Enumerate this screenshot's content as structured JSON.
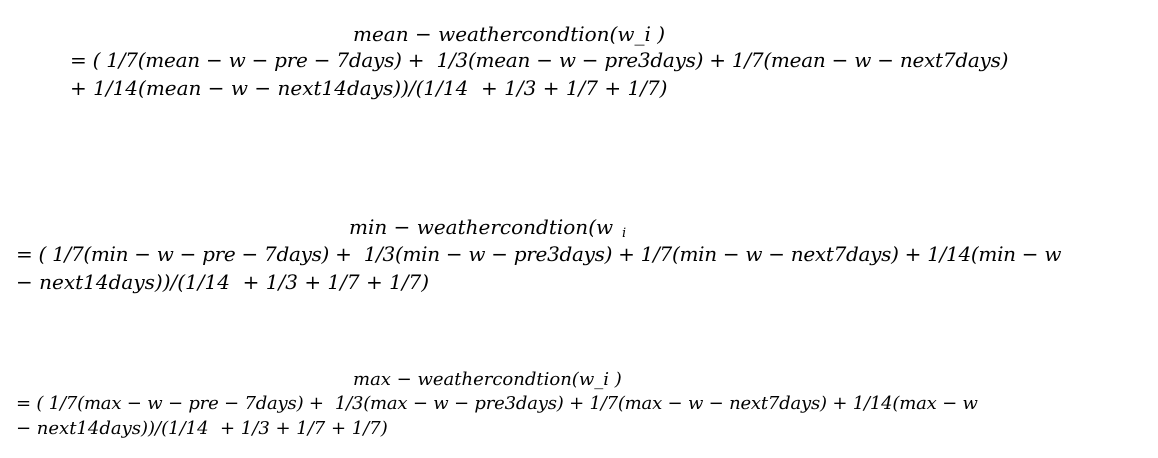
{
  "equations": [
    {
      "name": "mean",
      "lines": [
        "mean − weathercondtion(w_i )",
        "= ( 1/7(mean − w − pre − 7days) +  1/3(mean − w − pre3days) + 1/7(mean − w − next7days)",
        "+ 1/14(mean − w − next14days))/(1/14  + 1/3 + 1/7 + 1/7)"
      ]
    },
    {
      "name": "min",
      "lines": [
        "min − weathercondtion(w",
        "i",
        "= ( 1/7(min − w − pre − 7days) +  1/3(min − w − pre3days) + 1/7(min − w − next7days) + 1/14(min − w",
        "− next14days))/(1/14  + 1/3 + 1/7 + 1/7)"
      ]
    },
    {
      "name": "max",
      "lines": [
        "max − weathercondtion(w_i )",
        "= ( 1/7(max − w − pre − 7days) +  1/3(max − w − pre3days) + 1/7(max − w − next7days) + 1/14(max − w",
        "− next14days))/(1/14  + 1/3 + 1/7 + 1/7)"
      ]
    }
  ]
}
